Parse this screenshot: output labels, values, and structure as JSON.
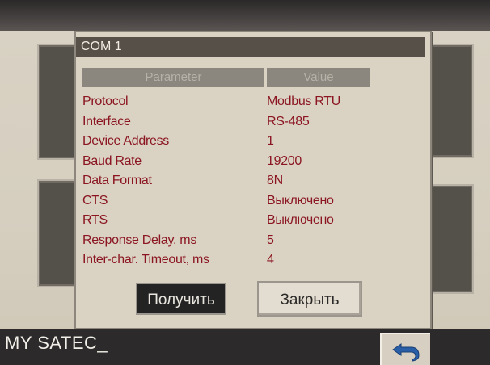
{
  "dialog": {
    "title": "COM 1",
    "columns": {
      "parameter": "Parameter",
      "value": "Value"
    },
    "rows": [
      {
        "parameter": "Protocol",
        "value": "Modbus RTU"
      },
      {
        "parameter": "Interface",
        "value": "RS-485"
      },
      {
        "parameter": "Device Address",
        "value": "1"
      },
      {
        "parameter": "Baud Rate",
        "value": "19200"
      },
      {
        "parameter": "Data Format",
        "value": "8N"
      },
      {
        "parameter": "CTS",
        "value": "Выключено"
      },
      {
        "parameter": "RTS",
        "value": "Выключено"
      },
      {
        "parameter": "Response Delay, ms",
        "value": "5"
      },
      {
        "parameter": "Inter-char. Timeout, ms",
        "value": "4"
      }
    ],
    "buttons": {
      "get": "Получить",
      "close": "Закрыть"
    }
  },
  "status_bar": {
    "text": "MY SATEC_",
    "back_icon": "back-arrow-icon"
  },
  "colors": {
    "value_text": "#8b1520",
    "titlebar": "#565049",
    "dialog_bg": "#dad3c4"
  }
}
